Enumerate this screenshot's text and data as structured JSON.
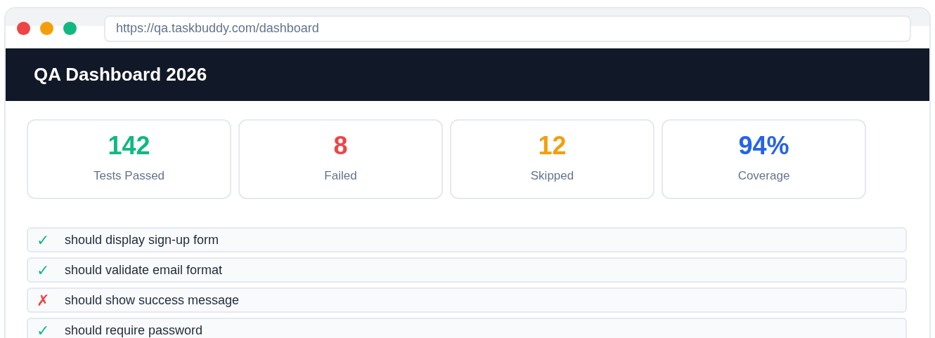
{
  "browser": {
    "url": "https://qa.taskbuddy.com/dashboard"
  },
  "header": {
    "title": "QA Dashboard 2026"
  },
  "stats": [
    {
      "value": "142",
      "label": "Tests Passed",
      "color": "#10b981"
    },
    {
      "value": "8",
      "label": "Failed",
      "color": "#ef4444"
    },
    {
      "value": "12",
      "label": "Skipped",
      "color": "#f59e0b"
    },
    {
      "value": "94%",
      "label": "Coverage",
      "color": "#2563eb"
    }
  ],
  "tests": [
    {
      "kind": "pass",
      "mark": "✓",
      "name": "should display sign-up form"
    },
    {
      "kind": "pass",
      "mark": "✓",
      "name": "should validate email format"
    },
    {
      "kind": "fail",
      "mark": "✗",
      "name": "should show success message"
    },
    {
      "kind": "pass",
      "mark": "✓",
      "name": "should require password"
    }
  ]
}
